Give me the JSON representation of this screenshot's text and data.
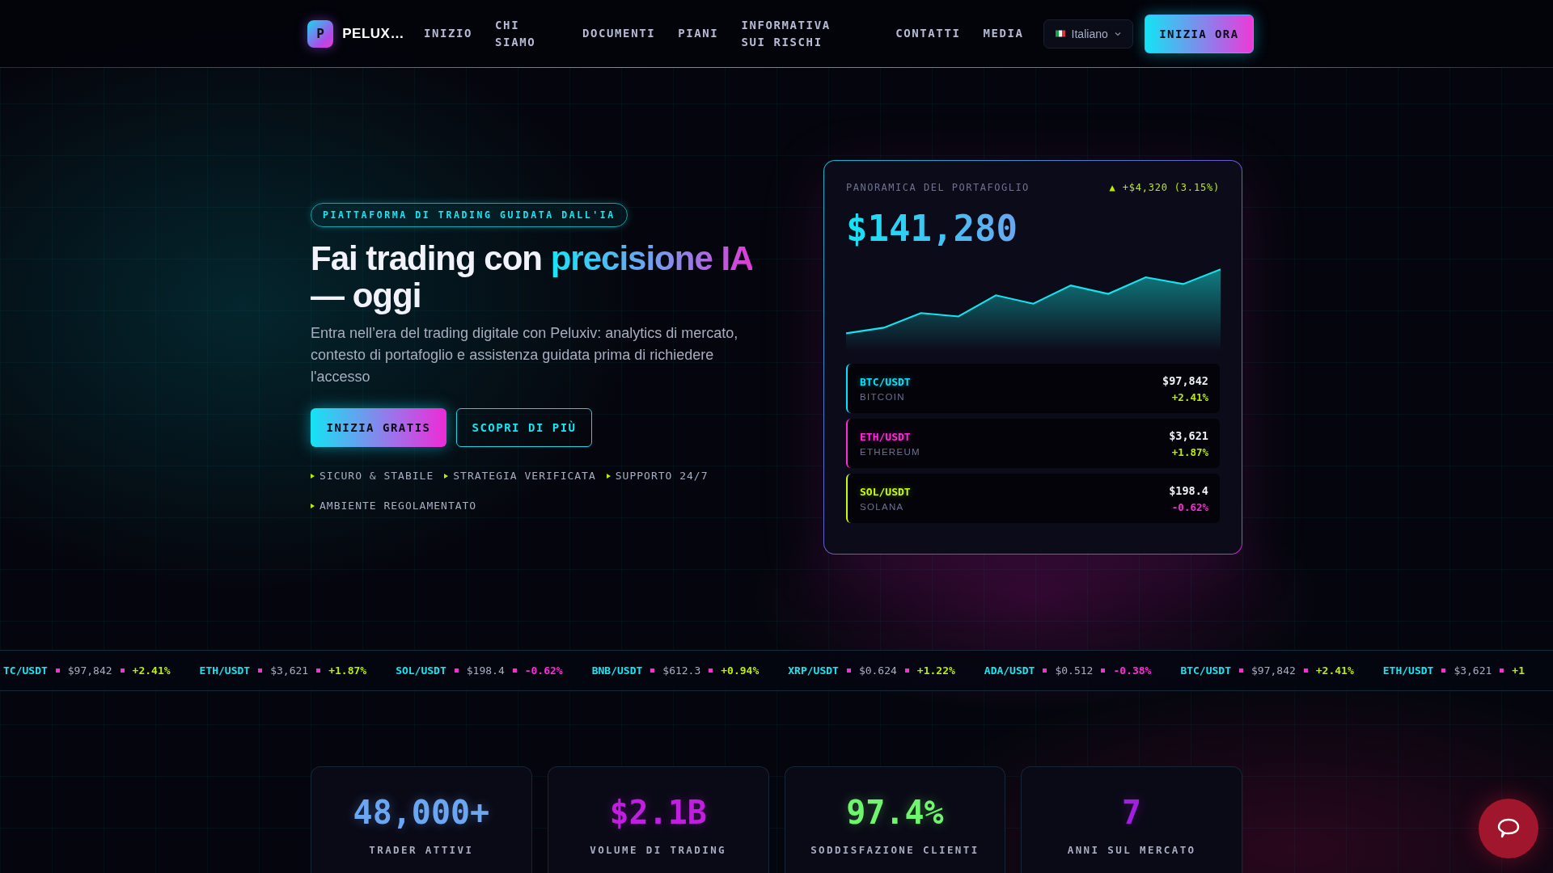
{
  "nav": {
    "logo_letter": "P",
    "brand": "PELUX…",
    "links": [
      {
        "label": "INIZIO"
      },
      {
        "label": "CHI SIAMO"
      },
      {
        "label": "DOCUMENTI"
      },
      {
        "label": "PIANI"
      },
      {
        "label": "INFORMATIVA SUI RISCHI"
      },
      {
        "label": "CONTATTI"
      },
      {
        "label": "MEDIA"
      }
    ],
    "language": "Italiano",
    "cta": "INIZIA ORA"
  },
  "hero": {
    "badge": "PIATTAFORMA DI TRADING GUIDATA DALL'IA",
    "title_start": "Fai trading con ",
    "title_highlight": "precisione IA",
    "title_end": " — oggi",
    "description": "Entra nell’era del trading digitale con Peluxiv: analytics di mercato, contesto di portafoglio e assistenza guidata prima di richiedere l'accesso",
    "buttons": [
      {
        "label": "INIZIA GRATIS",
        "kind": "primary"
      },
      {
        "label": "SCOPRI DI PIÙ",
        "kind": "outline"
      }
    ],
    "features": [
      "SICURO & STABILE",
      "STRATEGIA VERIFICATA",
      "SUPPORTO 24/7",
      "AMBIENTE REGOLAMENTATO"
    ]
  },
  "portfolio": {
    "title": "PANORAMICA DEL PORTAFOGLIO",
    "change": "▲ +$4,320 (3.15%)",
    "total": "$141,280",
    "assets": [
      {
        "pair": "BTC/USDT",
        "name": "BITCOIN",
        "price": "$97,842",
        "change": "+2.41%",
        "kind": "up",
        "color": "#00e5ff"
      },
      {
        "pair": "ETH/USDT",
        "name": "ETHEREUM",
        "price": "$3,621",
        "change": "+1.87%",
        "kind": "up",
        "color": "#ff2bd6"
      },
      {
        "pair": "SOL/USDT",
        "name": "SOLANA",
        "price": "$198.4",
        "change": "-0.62%",
        "kind": "down",
        "color": "#c6ff00"
      }
    ]
  },
  "ticker": [
    {
      "pair": "TC/USDT",
      "price": "$97,842",
      "change": "+2.41%",
      "kind": "up"
    },
    {
      "pair": "ETH/USDT",
      "price": "$3,621",
      "change": "+1.87%",
      "kind": "up"
    },
    {
      "pair": "SOL/USDT",
      "price": "$198.4",
      "change": "-0.62%",
      "kind": "down"
    },
    {
      "pair": "BNB/USDT",
      "price": "$612.3",
      "change": "+0.94%",
      "kind": "up"
    },
    {
      "pair": "XRP/USDT",
      "price": "$0.624",
      "change": "+1.22%",
      "kind": "up"
    },
    {
      "pair": "ADA/USDT",
      "price": "$0.512",
      "change": "-0.38%",
      "kind": "down"
    },
    {
      "pair": "BTC/USDT",
      "price": "$97,842",
      "change": "+2.41%",
      "kind": "up"
    },
    {
      "pair": "ETH/USDT",
      "price": "$3,621",
      "change": "+1",
      "kind": "up"
    }
  ],
  "stats": [
    {
      "value": "48,000+",
      "label": "TRADER ATTIVI",
      "color": "#6aa6f2"
    },
    {
      "value": "$2.1B",
      "label": "VOLUME DI TRADING",
      "color": "#c01fe0"
    },
    {
      "value": "97.4%",
      "label": "SODDISFAZIONE CLIENTI",
      "color": "#6ff56e"
    },
    {
      "value": "7",
      "label": "ANNI SUL MERCATO",
      "color": "#a21ee0"
    }
  ]
}
